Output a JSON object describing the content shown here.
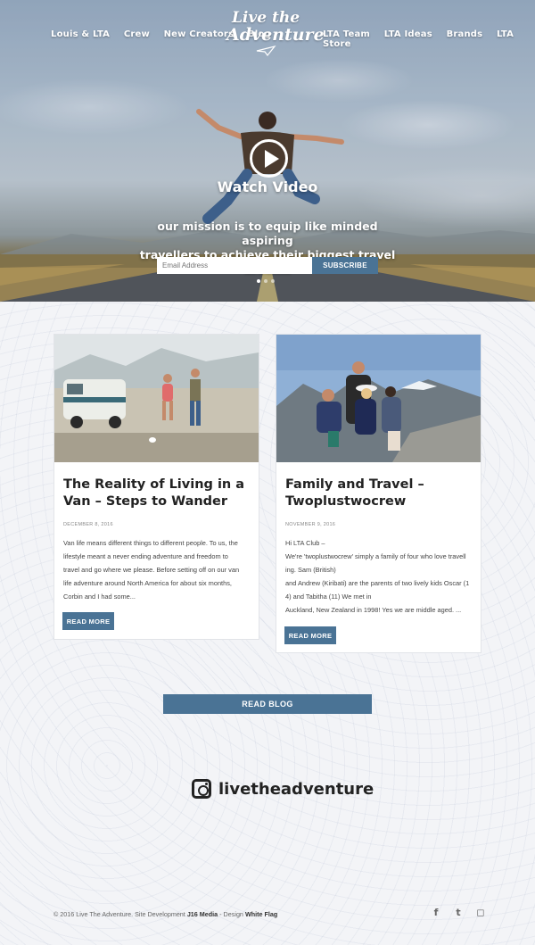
{
  "nav_left": [
    "Louis & LTA",
    "Crew",
    "New Creators",
    "Blog"
  ],
  "nav_right": [
    "LTA Team",
    "LTA Ideas",
    "Brands",
    "LTA Store"
  ],
  "logo": {
    "line1": "Live the",
    "line2": "Adventure"
  },
  "hero": {
    "watch_video": "Watch Video",
    "mission_line1": "our mission is to equip like minded aspiring",
    "mission_line2": "travellers to achieve their biggest travel dreams",
    "email_placeholder": "Email Address",
    "subscribe_label": "SUBSCRIBE",
    "slider_dots": 3
  },
  "posts": [
    {
      "title": "The Reality of Living in a Van – Steps to Wander",
      "date": "DECEMBER 8, 2016",
      "body": [
        "Van life means different things to different people. To us, the",
        "lifestyle meant a never ending adventure and freedom to",
        "travel and go where we please. Before setting off on our van",
        "life adventure around North America for about six months,",
        "Corbin and I had some..."
      ],
      "read_more": "READ MORE"
    },
    {
      "title": "Family and Travel – Twoplustwocrew",
      "date": "NOVEMBER 9, 2016",
      "body": [
        "Hi LTA Club –",
        "We're 'twoplustwocrew' simply a family of four who love travell",
        "ing. Sam (British)",
        "and Andrew (Kiribati) are the parents of two lively kids Oscar (1",
        "4) and Tabitha (11) We met in",
        "Auckland, New Zealand in 1998! Yes we are middle aged.     ..."
      ],
      "read_more": "READ MORE"
    }
  ],
  "read_blog": "READ BLOG",
  "instagram": {
    "handle": "livetheadventure",
    "icon": "instagram-icon"
  },
  "footer": {
    "prefix": "© 2016 Live The Adventure. Site Development ",
    "dev": "J16 Media",
    "middle": " - Design ",
    "design": "White Flag"
  },
  "social": [
    {
      "icon": "facebook-icon",
      "glyph": "f"
    },
    {
      "icon": "twitter-icon",
      "glyph": "t"
    },
    {
      "icon": "instagram-icon",
      "glyph": "◻"
    }
  ],
  "colors": {
    "accent": "#4a7395",
    "text": "#222222",
    "background": "#f4f5f8"
  }
}
